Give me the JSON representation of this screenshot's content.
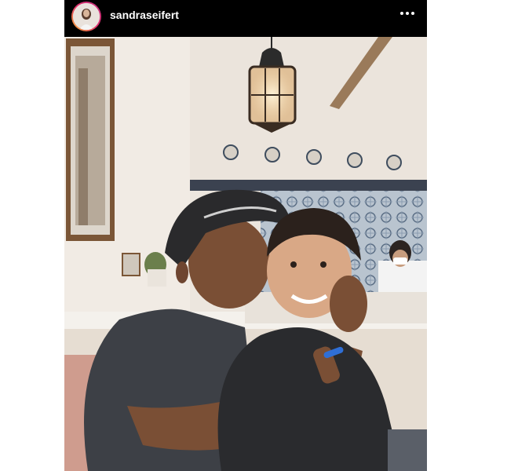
{
  "post": {
    "username": "sandraseifert",
    "avatar_icon": "profile-avatar",
    "menu_icon": "more-options-icon"
  }
}
